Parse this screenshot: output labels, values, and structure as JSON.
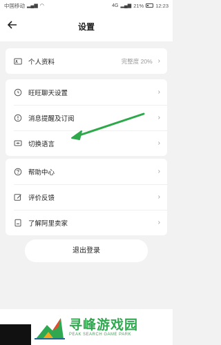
{
  "status_bar": {
    "carrier": "中国移动",
    "network": "4G",
    "battery": "21%",
    "time": "12:23"
  },
  "header": {
    "title": "设置"
  },
  "groups": [
    {
      "items": [
        {
          "label": "个人资料",
          "value": "完整度 20%",
          "icon": "id-card-icon"
        }
      ]
    },
    {
      "items": [
        {
          "label": "旺旺聊天设置",
          "icon": "clock-icon"
        },
        {
          "label": "消息提醒及订阅",
          "icon": "bell-icon"
        },
        {
          "label": "切换语言",
          "icon": "language-icon"
        }
      ]
    },
    {
      "items": [
        {
          "label": "帮助中心",
          "icon": "help-icon"
        },
        {
          "label": "评价反馈",
          "icon": "edit-icon"
        },
        {
          "label": "了解阿里卖家",
          "icon": "book-icon"
        }
      ]
    }
  ],
  "logout_label": "退出登录",
  "annotation_color": "#2ea84a",
  "watermark": {
    "title": "寻峰游戏园",
    "subtitle": "PEAK SEARCH GAME PARK"
  }
}
